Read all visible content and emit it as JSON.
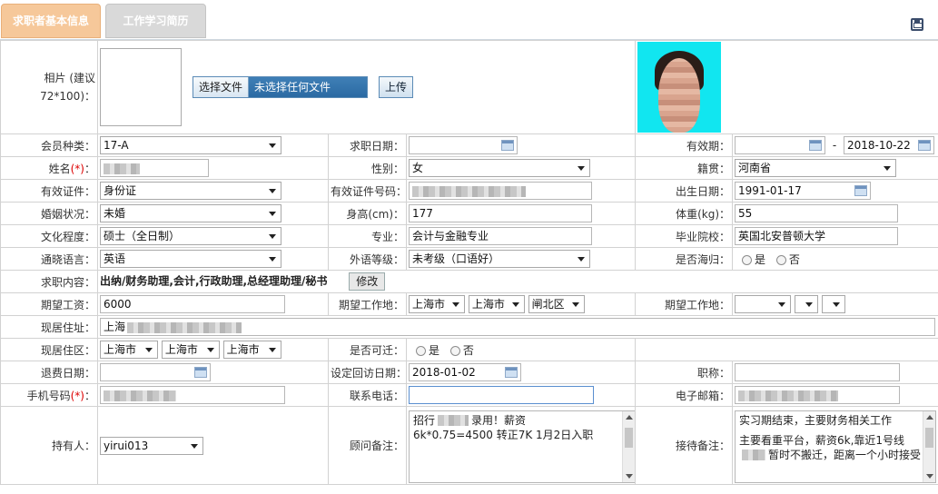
{
  "tabs": [
    {
      "label": "求职者基本信息"
    },
    {
      "label": "工作学习简历"
    }
  ],
  "photo": {
    "label": "相片 (建议72*100)：",
    "file_button": "选择文件",
    "file_status": "未选择任何文件",
    "upload_button": "上传"
  },
  "fields": {
    "member_type": {
      "label": "会员种类：",
      "value": "17-A"
    },
    "job_date": {
      "label": "求职日期：",
      "value": ""
    },
    "valid_period": {
      "label": "有效期：",
      "start": "",
      "sep": "-",
      "end": "2018-10-22"
    },
    "name": {
      "label": "姓名",
      "req": "(*)",
      "colon": "："
    },
    "gender": {
      "label": "性别：",
      "value": "女"
    },
    "native": {
      "label": "籍贯：",
      "value": "河南省"
    },
    "id_type": {
      "label": "有效证件：",
      "value": "身份证"
    },
    "id_number": {
      "label": "有效证件号码："
    },
    "birth": {
      "label": "出生日期：",
      "value": "1991-01-17"
    },
    "marital": {
      "label": "婚姻状况：",
      "value": "未婚"
    },
    "height": {
      "label": "身高(cm)：",
      "value": "177"
    },
    "weight": {
      "label": "体重(kg)：",
      "value": "55"
    },
    "education": {
      "label": "文化程度：",
      "value": "硕士（全日制）"
    },
    "major": {
      "label": "专业：",
      "value": "会计与金融专业"
    },
    "school": {
      "label": "毕业院校：",
      "value": "英国北安普顿大学"
    },
    "language": {
      "label": "通晓语言：",
      "value": "英语"
    },
    "lang_level": {
      "label": "外语等级：",
      "value": "未考级（口语好）"
    },
    "returnee": {
      "label": "是否海归：",
      "yes": "是",
      "no": "否"
    },
    "job_content": {
      "label": "求职内容：",
      "value": "出纳/财务助理,会计,行政助理,总经理助理/秘书",
      "edit_button": "修改"
    },
    "salary": {
      "label": "期望工资：",
      "value": "6000"
    },
    "work_place1": {
      "label": "期望工作地：",
      "province": "上海市",
      "city": "上海市",
      "district": "闸北区"
    },
    "work_place2": {
      "label": "期望工作地："
    },
    "address": {
      "label": "现居住址：",
      "value": "上海"
    },
    "residence": {
      "label": "现居住区：",
      "province": "上海市",
      "city": "上海市",
      "district": "上海市"
    },
    "relocate": {
      "label": "是否可迁：",
      "yes": "是",
      "no": "否"
    },
    "refund_date": {
      "label": "退费日期：",
      "value": ""
    },
    "callback_date": {
      "label": "设定回访日期：",
      "value": "2018-01-02"
    },
    "title": {
      "label": "职称：",
      "value": ""
    },
    "mobile": {
      "label": "手机号码",
      "req": "(*)",
      "colon": "："
    },
    "phone": {
      "label": "联系电话：",
      "value": ""
    },
    "email": {
      "label": "电子邮箱："
    },
    "holder": {
      "label": "持有人：",
      "value": "yirui013"
    },
    "advisor_note": {
      "label": "顾问备注：",
      "line1a": "招行",
      "line1b": "录用！薪资",
      "line2": "6k*0.75=4500 转正7K 1月2日入职"
    },
    "reception_note": {
      "label": "接待备注：",
      "line1": "实习期结束，主要财务相关工作",
      "line2a": "主要看重平台，薪资6k,靠近1号线",
      "line2b": "暂时不搬迁，距离一个小时接受"
    }
  }
}
